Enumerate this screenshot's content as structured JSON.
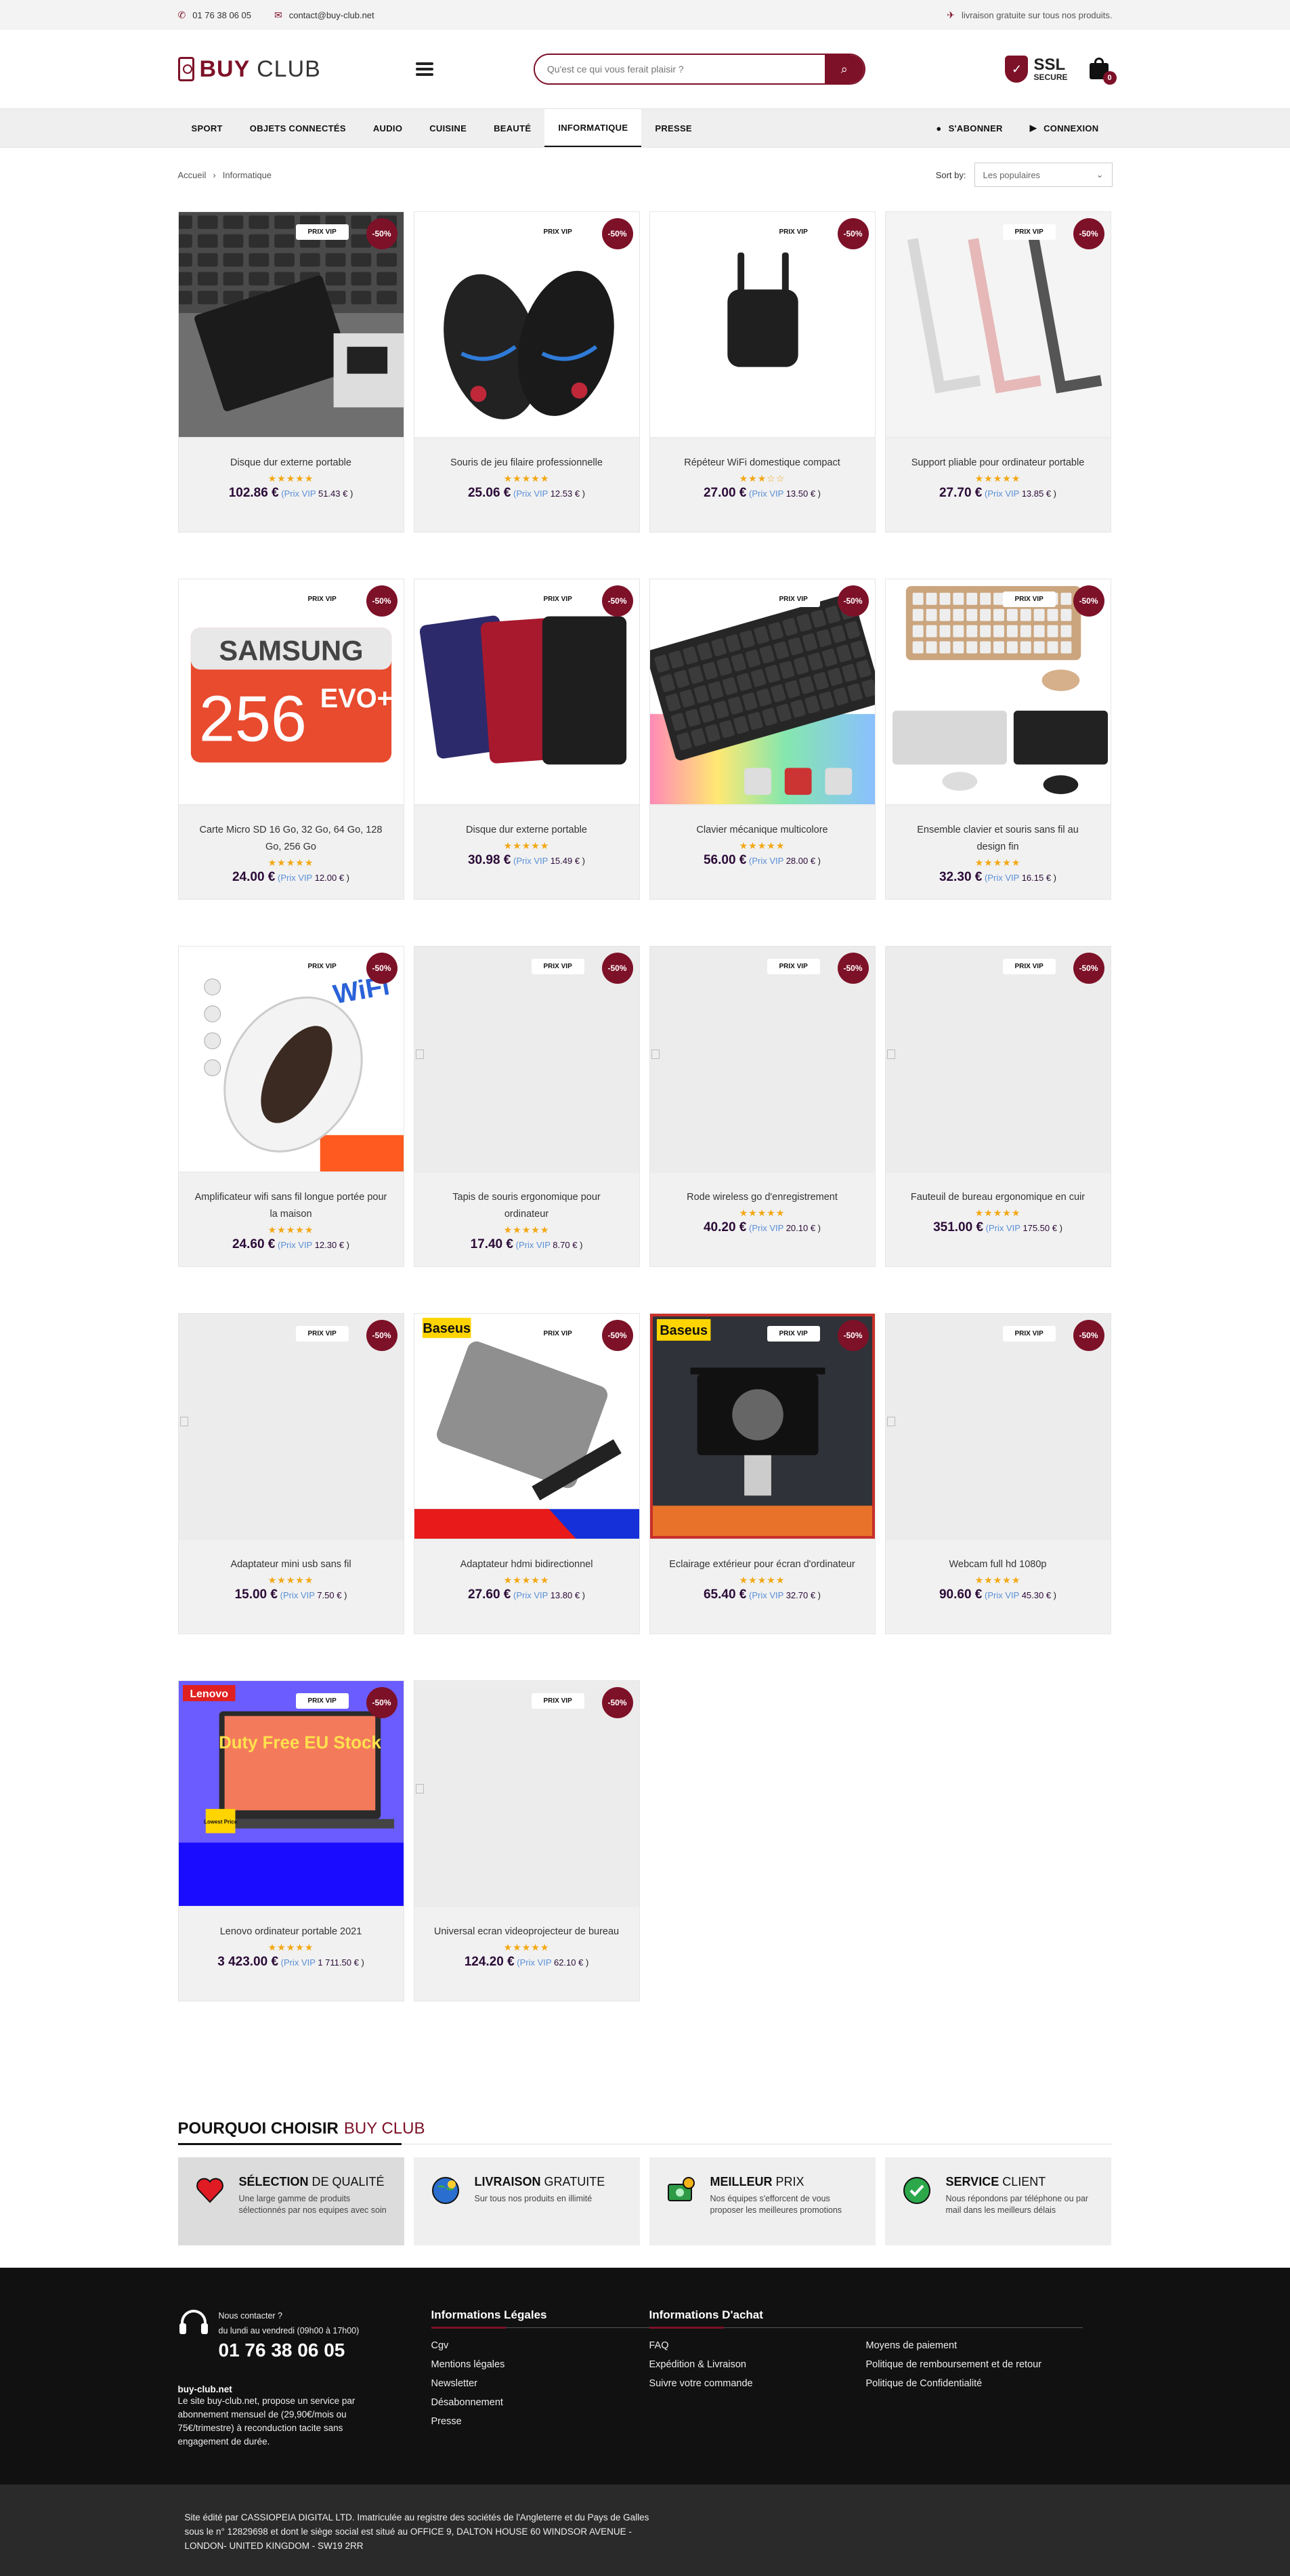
{
  "topbar": {
    "phone": "01 76 38 06 05",
    "email": "contact@buy-club.net",
    "shipping": "livraison gratuite sur tous nos produits."
  },
  "header": {
    "logo_buy": "BUY",
    "logo_club": "CLUB",
    "search_placeholder": "Qu'est ce qui vous ferait plaisir ?",
    "ssl_big": "SSL",
    "ssl_small": "SECURE",
    "cart_count": "0"
  },
  "nav": {
    "items": [
      "SPORT",
      "OBJETS CONNECTÉS",
      "AUDIO",
      "CUISINE",
      "BEAUTÉ",
      "INFORMATIQUE",
      "PRESSE"
    ],
    "active": "INFORMATIQUE",
    "subscribe": "S'ABONNER",
    "login": "CONNEXION"
  },
  "breadcrumb": {
    "home": "Accueil",
    "sep": "›",
    "current": "Informatique"
  },
  "sort": {
    "label": "Sort by:",
    "value": "Les populaires"
  },
  "badges": {
    "vip": "PRIX VIP",
    "discount": "-50%",
    "vip_label": "Prix VIP"
  },
  "products": [
    {
      "name": "Disque dur externe portable",
      "price": "102.86 €",
      "vip": "51.43 €",
      "rating": 4.5,
      "stars": "★★★★★",
      "img": "hdd-laptop"
    },
    {
      "name": "Souris de jeu filaire professionnelle",
      "price": "25.06 €",
      "vip": "12.53 €",
      "rating": 4.5,
      "stars": "★★★★★",
      "img": "mouse"
    },
    {
      "name": "Répéteur WiFi domestique compact",
      "price": "27.00 €",
      "vip": "13.50 €",
      "rating": 3.5,
      "stars": "★★★☆☆",
      "img": "repeater"
    },
    {
      "name": "Support pliable pour ordinateur portable",
      "price": "27.70 €",
      "vip": "13.85 €",
      "rating": 4.5,
      "stars": "★★★★★",
      "img": "stand"
    },
    {
      "name": "Carte Micro SD 16 Go, 32 Go, 64 Go, 128 Go, 256 Go",
      "price": "24.00 €",
      "vip": "12.00 €",
      "rating": 4.5,
      "stars": "★★★★★",
      "img": "sd"
    },
    {
      "name": "Disque dur externe portable",
      "price": "30.98 €",
      "vip": "15.49 €",
      "rating": 4.5,
      "stars": "★★★★★",
      "img": "hdd-colors"
    },
    {
      "name": "Clavier mécanique multicolore",
      "price": "56.00 €",
      "vip": "28.00 €",
      "rating": 4.5,
      "stars": "★★★★★",
      "img": "keyboard-rgb"
    },
    {
      "name": "Ensemble clavier et souris sans fil au design fin",
      "price": "32.30 €",
      "vip": "16.15 €",
      "rating": 4.5,
      "stars": "★★★★★",
      "img": "keyboards"
    },
    {
      "name": "Amplificateur wifi sans fil longue portée pour la maison",
      "price": "24.60 €",
      "vip": "12.30 €",
      "rating": 4.5,
      "stars": "★★★★★",
      "img": "wifi-amp"
    },
    {
      "name": "Tapis de souris ergonomique pour ordinateur",
      "price": "17.40 €",
      "vip": "8.70 €",
      "rating": 4.5,
      "stars": "★★★★★",
      "img": "broken"
    },
    {
      "name": "Rode wireless go d'enregistrement",
      "price": "40.20 €",
      "vip": "20.10 €",
      "rating": 4.5,
      "stars": "★★★★★",
      "img": "broken"
    },
    {
      "name": "Fauteuil de bureau ergonomique en cuir",
      "price": "351.00 €",
      "vip": "175.50 €",
      "rating": 4.5,
      "stars": "★★★★★",
      "img": "broken"
    },
    {
      "name": "Adaptateur mini usb sans fil",
      "price": "15.00 €",
      "vip": "7.50 €",
      "rating": 4.5,
      "stars": "★★★★★",
      "img": "broken"
    },
    {
      "name": "Adaptateur hdmi bidirectionnel",
      "price": "27.60 €",
      "vip": "13.80 €",
      "rating": 4.5,
      "stars": "★★★★★",
      "img": "hdmi"
    },
    {
      "name": "Eclairage extérieur pour écran d'ordinateur",
      "price": "65.40 €",
      "vip": "32.70 €",
      "rating": 4.5,
      "stars": "★★★★★",
      "img": "lamp"
    },
    {
      "name": "Webcam full hd 1080p",
      "price": "90.60 €",
      "vip": "45.30 €",
      "rating": 4.5,
      "stars": "★★★★★",
      "img": "broken"
    },
    {
      "name": "Lenovo ordinateur portable 2021",
      "price": "3 423.00 €",
      "vip": "1 711.50 €",
      "rating": 4.5,
      "stars": "★★★★★",
      "img": "lenovo"
    },
    {
      "name": "Universal ecran videoprojecteur de bureau",
      "price": "124.20 €",
      "vip": "62.10 €",
      "rating": 5,
      "stars": "★★★★★",
      "img": "broken"
    }
  ],
  "image_text": {
    "samsung": "SAMSUNG",
    "sd_size": "256",
    "sd_evo": "EVO+",
    "baseus": "Baseus",
    "lenovo": "Lenovo",
    "lenovo_promo": "Duty Free EU Stock",
    "lowest": "Lowest Price",
    "wifi": "WiFi"
  },
  "why": {
    "title_a": "POURQUOI CHOISIR",
    "title_b": "BUY CLUB",
    "cards": [
      {
        "h1": "SÉLECTION",
        "h2": "DE QUALITÉ",
        "p": "Une large gamme de produits sélectionnés par nos equipes avec soin",
        "icon": "heart-icon"
      },
      {
        "h1": "LIVRAISON",
        "h2": "GRATUITE",
        "p": "Sur tous nos produits en illimité",
        "icon": "globe-icon"
      },
      {
        "h1": "MEILLEUR",
        "h2": "PRIX",
        "p": "Nos équipes s'efforcent de vous proposer les meilleures promotions",
        "icon": "money-icon"
      },
      {
        "h1": "SERVICE",
        "h2": "CLIENT",
        "p": "Nous répondons par téléphone ou par mail dans les meilleurs délais",
        "icon": "check-icon"
      }
    ]
  },
  "footer": {
    "contact_l1": "Nous contacter ?",
    "contact_l2": "du lundi au vendredi (09h00 à 17h00)",
    "phone": "01 76 38 06 05",
    "brand": "buy-club.net",
    "desc": "Le site buy-club.net, propose un service par abonnement mensuel de (29,90€/mois ou 75€/trimestre) à reconduction tacite sans engagement de durée.",
    "legal_title": "Informations Légales",
    "legal_links": [
      "Cgv",
      "Mentions légales",
      "Newsletter",
      "Désabonnement",
      "Presse"
    ],
    "achat_title": "Informations D'achat",
    "achat_col1": [
      "FAQ",
      "Expédition & Livraison",
      "Suivre votre commande"
    ],
    "achat_col2": [
      "Moyens de paiement",
      "Politique de remboursement et de retour",
      "Politique de Confidentialité"
    ],
    "bottom": "Site édité par CASSIOPEIA DIGITAL LTD. Imatriculée au registre des sociétés de l'Angleterre et du Pays de Galles sous le n° 12829698 et dont le siège social est situé au OFFICE 9, DALTON HOUSE 60 WINDSOR AVENUE - LONDON- UNITED KINGDOM - SW19 2RR"
  },
  "colors": {
    "brand": "#7d1128",
    "price": "#2b0b37",
    "vip_label": "#5a8fd6",
    "stars": "#f3a712"
  }
}
